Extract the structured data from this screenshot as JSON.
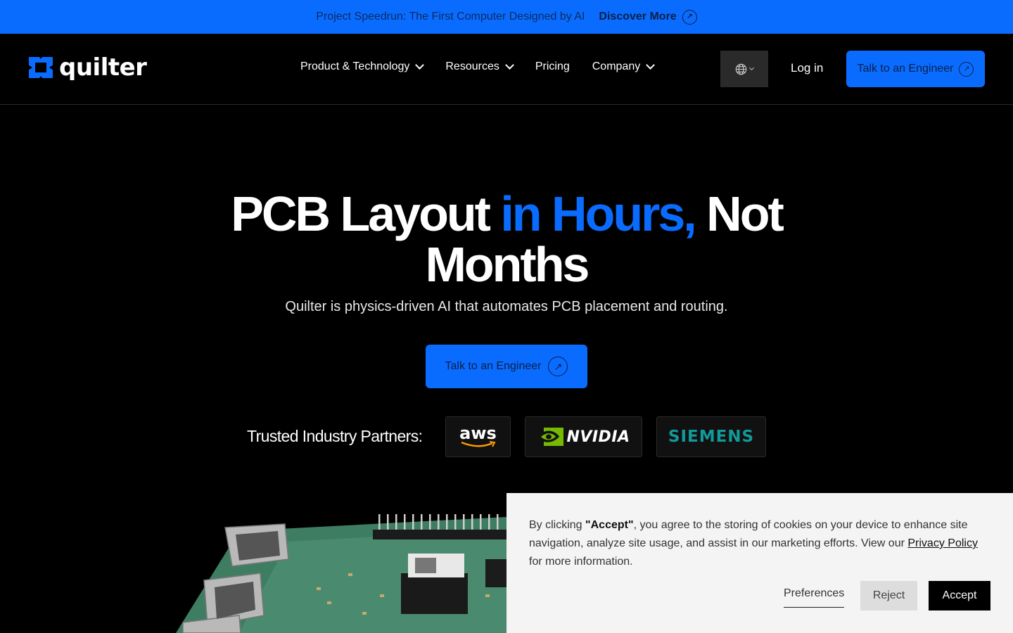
{
  "announcement": {
    "text": "Project Speedrun: The First Computer Designed by AI",
    "link_label": "Discover More",
    "link_icon": "arrow-up-right-circle-icon"
  },
  "nav": {
    "logo_text": "quilter",
    "items": [
      {
        "label": "Product & Technology",
        "has_dropdown": true
      },
      {
        "label": "Resources",
        "has_dropdown": true
      },
      {
        "label": "Pricing",
        "has_dropdown": false
      },
      {
        "label": "Company",
        "has_dropdown": true
      }
    ],
    "language_icon": "globe-icon",
    "login_label": "Log in",
    "cta_label": "Talk to an Engineer"
  },
  "hero": {
    "title_part1": "PCB Layout",
    "title_accent": "in Hours,",
    "title_part2": "Not",
    "title_line2": "Months",
    "subtitle": "Quilter is physics-driven AI that automates PCB placement and routing.",
    "cta_label": "Talk to an Engineer"
  },
  "partners": {
    "label": "Trusted Industry Partners:",
    "logos": [
      {
        "name": "aws"
      },
      {
        "name": "NVIDIA"
      },
      {
        "name": "SIEMENS"
      }
    ]
  },
  "cookie": {
    "text_before": "By clicking ",
    "text_bold": "\"Accept\"",
    "text_after": ", you agree to the storing of cookies on your device to enhance site navigation, analyze site usage, and assist in our marketing efforts. View our ",
    "privacy_link": "Privacy Policy",
    "text_end": " for more information.",
    "preferences_label": "Preferences",
    "reject_label": "Reject",
    "accept_label": "Accept"
  },
  "colors": {
    "brand_blue": "#0a6cff",
    "background": "#000000",
    "siemens_teal": "#139999",
    "nvidia_green": "#76b900"
  }
}
